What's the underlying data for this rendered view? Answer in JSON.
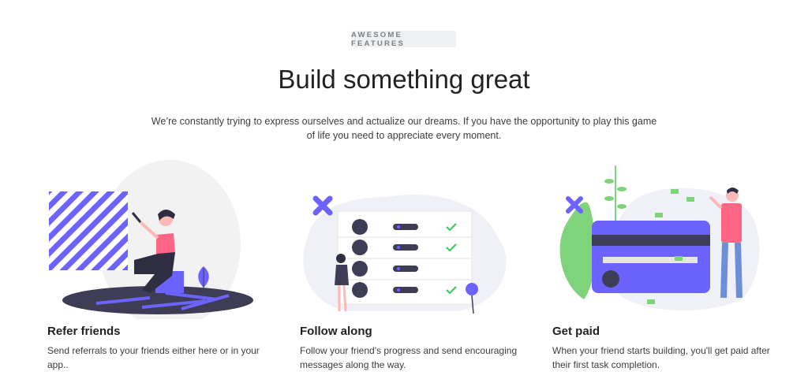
{
  "header": {
    "badge": "AWESOME FEATURES",
    "title": "Build something great",
    "lead": "We’re constantly trying to express ourselves and actualize our dreams. If you have the opportunity to play this game of life you need to appreciate every moment."
  },
  "features": [
    {
      "illustration": "refer-friends-illustration",
      "title": "Refer friends",
      "text": "Send referrals to your friends either here or in your app.."
    },
    {
      "illustration": "follow-along-illustration",
      "title": "Follow along",
      "text": "Follow your friend's progress and send encouraging messages along the way."
    },
    {
      "illustration": "get-paid-illustration",
      "title": "Get paid",
      "text": "When your friend starts building, you'll get paid after their first task completion."
    }
  ],
  "colors": {
    "accent": "#6c63ff",
    "dark": "#3f3d56",
    "green": "#7ed37b",
    "check": "#34c759",
    "pink": "#ff6584",
    "light_bg": "#f0f0f7"
  }
}
